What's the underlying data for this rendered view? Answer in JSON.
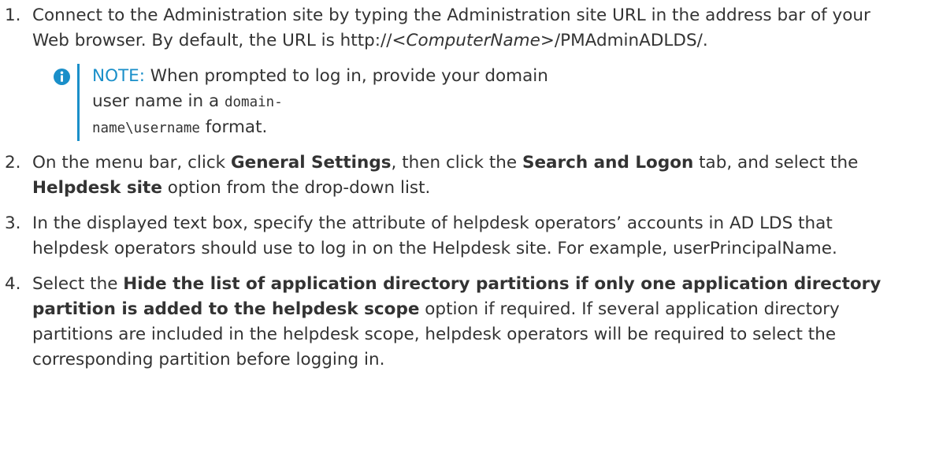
{
  "steps": [
    {
      "number": "1.",
      "text_before": "Connect to the Administration site by typing the Administration site URL in the address bar of your Web browser. By default, the URL is http://<",
      "italic": "ComputerName",
      "text_after": ">/PMAdminADLDS/."
    },
    {
      "number": "2.",
      "t1": "On the menu bar, click ",
      "b1": "General Settings",
      "t2": ", then click the ",
      "b2": "Search and Logon",
      "t3": " tab, and select the ",
      "b3": "Helpdesk site",
      "t4": " option from the drop-down list."
    },
    {
      "number": "3.",
      "text": "In the displayed text box, specify the attribute of helpdesk operators’ accounts in AD LDS that helpdesk operators should use to log in on the Helpdesk site. For example, userPrincipalName."
    },
    {
      "number": "4.",
      "t1": "Select the ",
      "b1": "Hide the list of application directory partitions if only one application directory partition is added to the helpdesk scope",
      "t2": " option if required. If several application directory partitions are included in the helpdesk scope, helpdesk operators will be required to select the corresponding partition before logging in."
    }
  ],
  "note": {
    "label": "NOTE:",
    "text_before": " When prompted to log in, provide your domain user name in a ",
    "code_part1": "domain-",
    "code_part2": "name\\username",
    "text_after": " format.",
    "icon": "info-icon",
    "accent_color": "#1a8fc9"
  }
}
